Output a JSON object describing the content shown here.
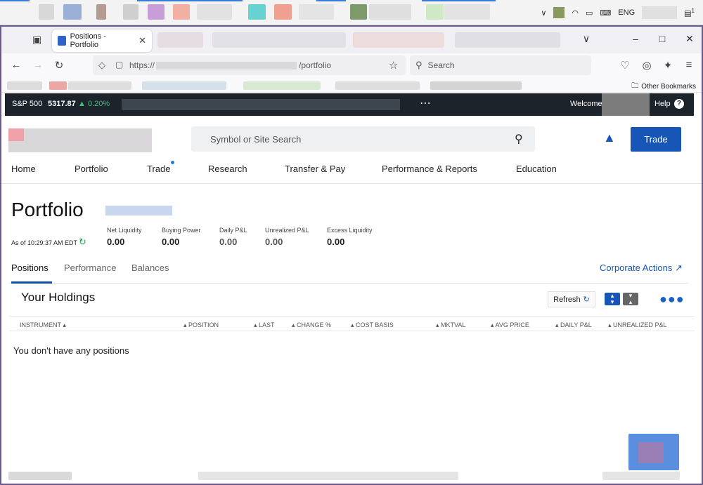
{
  "taskbar": {
    "lang": "ENG",
    "notif_count": "1"
  },
  "browser": {
    "tab_title": "Positions - Portfolio",
    "url_prefix": "https://",
    "url_suffix": "/portfolio",
    "search_placeholder": "Search",
    "other_bookmarks": "Other Bookmarks"
  },
  "ticker": {
    "index_name": "S&P 500",
    "index_value": "5317.87",
    "index_change": "▲ 0.20%",
    "welcome": "Welcome",
    "help": "Help"
  },
  "site": {
    "search_placeholder": "Symbol or Site Search",
    "trade_button": "Trade",
    "nav": [
      "Home",
      "Portfolio",
      "Trade",
      "Research",
      "Transfer & Pay",
      "Performance & Reports",
      "Education"
    ]
  },
  "portfolio": {
    "title": "Portfolio",
    "as_of": "As of 10:29:37 AM EDT",
    "metrics": [
      {
        "label": "Net Liquidity",
        "value": "0.00"
      },
      {
        "label": "Buying Power",
        "value": "0.00"
      },
      {
        "label": "Daily P&L",
        "value": "0.00"
      },
      {
        "label": "Unrealized P&L",
        "value": "0.00"
      },
      {
        "label": "Excess Liquidity",
        "value": "0.00"
      }
    ],
    "tabs": [
      "Positions",
      "Performance",
      "Balances"
    ],
    "corporate_actions": "Corporate Actions",
    "holdings_title": "Your Holdings",
    "refresh": "Refresh",
    "columns": [
      "INSTRUMENT",
      "POSITION",
      "LAST",
      "CHANGE %",
      "COST BASIS",
      "MKTVAL",
      "AVG PRICE",
      "DAILY P&L",
      "UNREALIZED P&L"
    ],
    "empty_message": "You don't have any positions"
  },
  "colors": {
    "accent": "#1756b7",
    "ticker_bg": "#1d232b",
    "positive": "#3cc47c"
  }
}
